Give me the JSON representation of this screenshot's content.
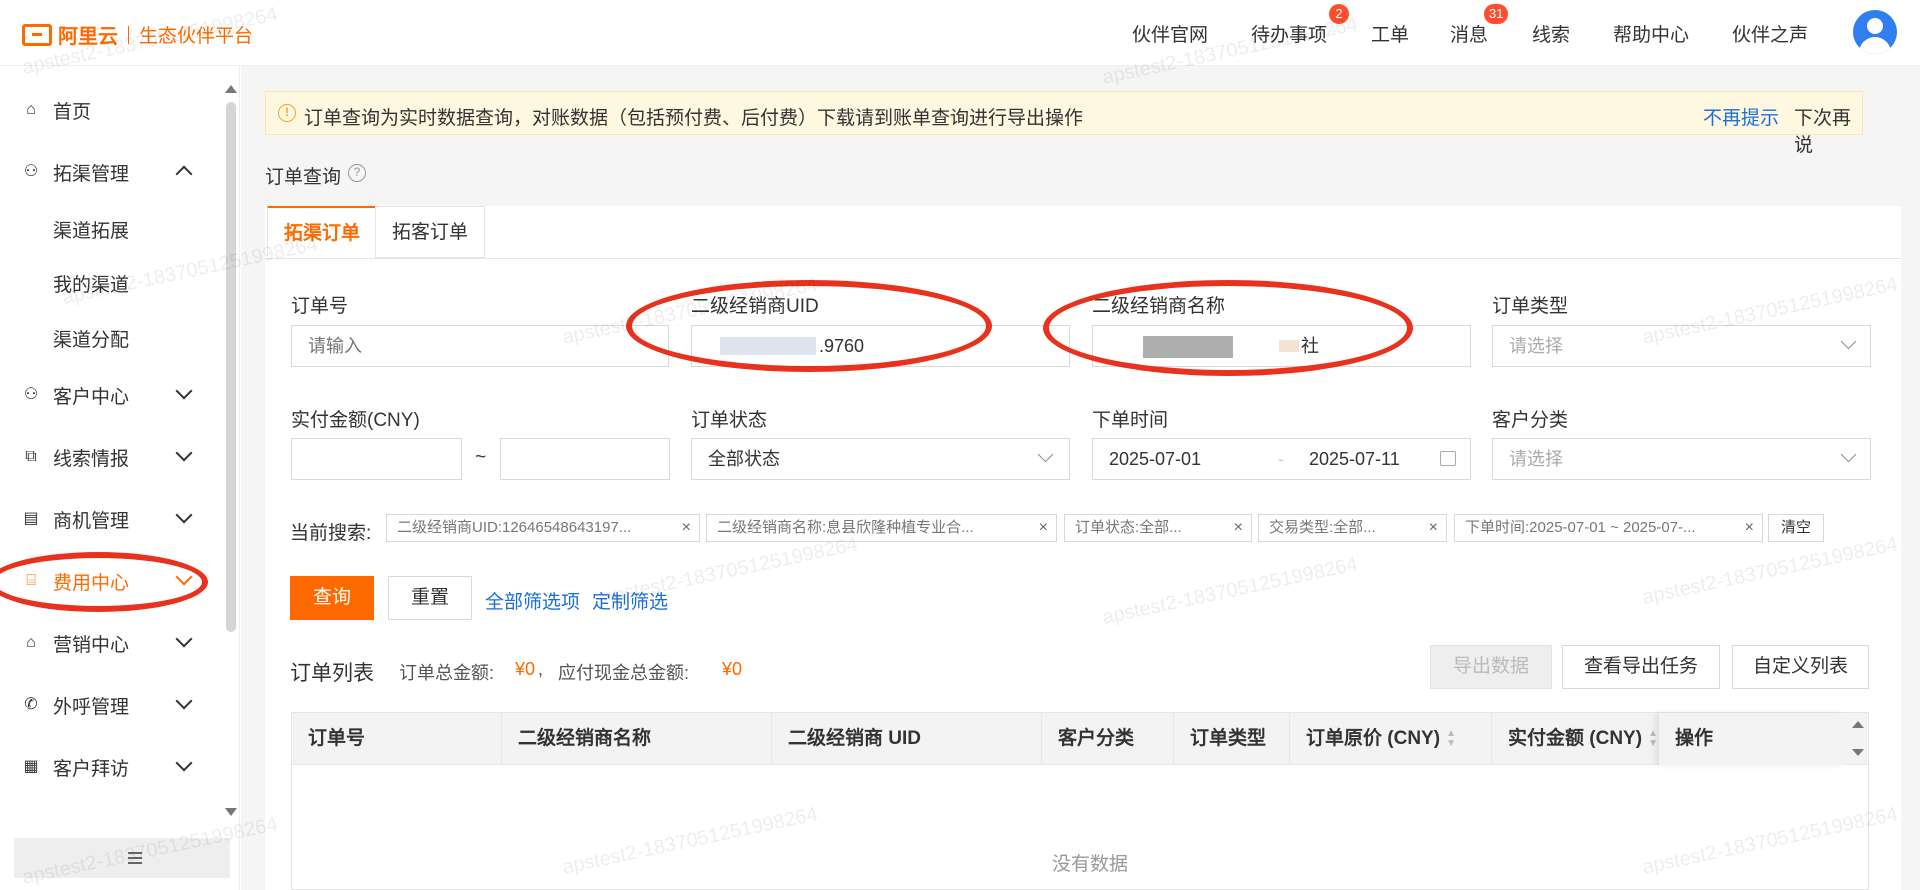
{
  "header": {
    "logo_text": "阿里云",
    "platform_name": "生态伙伴平台",
    "nav": [
      {
        "label": "伙伴官网"
      },
      {
        "label": "待办事项",
        "badge": "2"
      },
      {
        "label": "工单"
      },
      {
        "label": "消息",
        "badge": "31"
      },
      {
        "label": "线索"
      },
      {
        "label": "帮助中心"
      },
      {
        "label": "伙伴之声"
      }
    ]
  },
  "sidebar": {
    "items": [
      {
        "label": "首页",
        "icon": "home-icon"
      },
      {
        "label": "拓渠管理",
        "icon": "partner-icon",
        "expanded": true,
        "children": [
          {
            "label": "渠道拓展"
          },
          {
            "label": "我的渠道"
          },
          {
            "label": "渠道分配"
          }
        ]
      },
      {
        "label": "客户中心",
        "icon": "user-icon"
      },
      {
        "label": "线索情报",
        "icon": "node-icon"
      },
      {
        "label": "商机管理",
        "icon": "doc-icon"
      },
      {
        "label": "费用中心",
        "icon": "fee-icon",
        "active": true
      },
      {
        "label": "营销中心",
        "icon": "bag-icon"
      },
      {
        "label": "外呼管理",
        "icon": "phone-icon"
      },
      {
        "label": "客户拜访",
        "icon": "calendar-icon"
      }
    ]
  },
  "notice": {
    "text": "订单查询为实时数据查询，对账数据（包括预付费、后付费）下载请到账单查询进行导出操作",
    "dismiss_label": "不再提示",
    "later_label": "下次再说"
  },
  "page": {
    "title": "订单查询",
    "tabs": [
      {
        "label": "拓渠订单",
        "active": true
      },
      {
        "label": "拓客订单"
      }
    ]
  },
  "filters": {
    "order_no": {
      "label": "订单号",
      "placeholder": "请输入"
    },
    "uid": {
      "label": "二级经销商UID",
      "value": ".9760"
    },
    "name": {
      "label": "二级经销商名称",
      "value": "社"
    },
    "order_type": {
      "label": "订单类型",
      "placeholder": "请选择"
    },
    "amount": {
      "label": "实付金额(CNY)",
      "separator": "~"
    },
    "status": {
      "label": "订单状态",
      "value": "全部状态"
    },
    "order_time": {
      "label": "下单时间",
      "start": "2025-07-01",
      "end": "2025-07-11"
    },
    "customer_category": {
      "label": "客户分类",
      "placeholder": "请选择"
    }
  },
  "current_search": {
    "label": "当前搜索:",
    "chips": [
      "二级经销商UID:12646548643197...",
      "二级经销商名称:息县欣隆种植专业合...",
      "订单状态:全部...",
      "交易类型:全部...",
      "下单时间:2025-07-01 ~ 2025-07-..."
    ],
    "clear_label": "清空"
  },
  "actions": {
    "query": "查询",
    "reset": "重置",
    "all_filters": "全部筛选项",
    "custom_filters": "定制筛选"
  },
  "order_list": {
    "title": "订单列表",
    "total_label": "订单总金额:",
    "total_value": "¥0",
    "payable_label": "应付现金总金额:",
    "payable_value": "¥0",
    "separator": ",",
    "export_label": "导出数据",
    "view_export_label": "查看导出任务",
    "custom_columns_label": "自定义列表",
    "columns": [
      "订单号",
      "二级经销商名称",
      "二级经销商 UID",
      "客户分类",
      "订单类型",
      "订单原价 (CNY)",
      "实付金额 (CNY)",
      "操作"
    ],
    "empty_text": "没有数据"
  },
  "watermark_text": "apstest2-1837051251998264",
  "colors": {
    "accent": "#ff6a00",
    "link": "#1a6fd8",
    "annotation": "#e8321e",
    "notice_bg": "#fff8e0"
  }
}
